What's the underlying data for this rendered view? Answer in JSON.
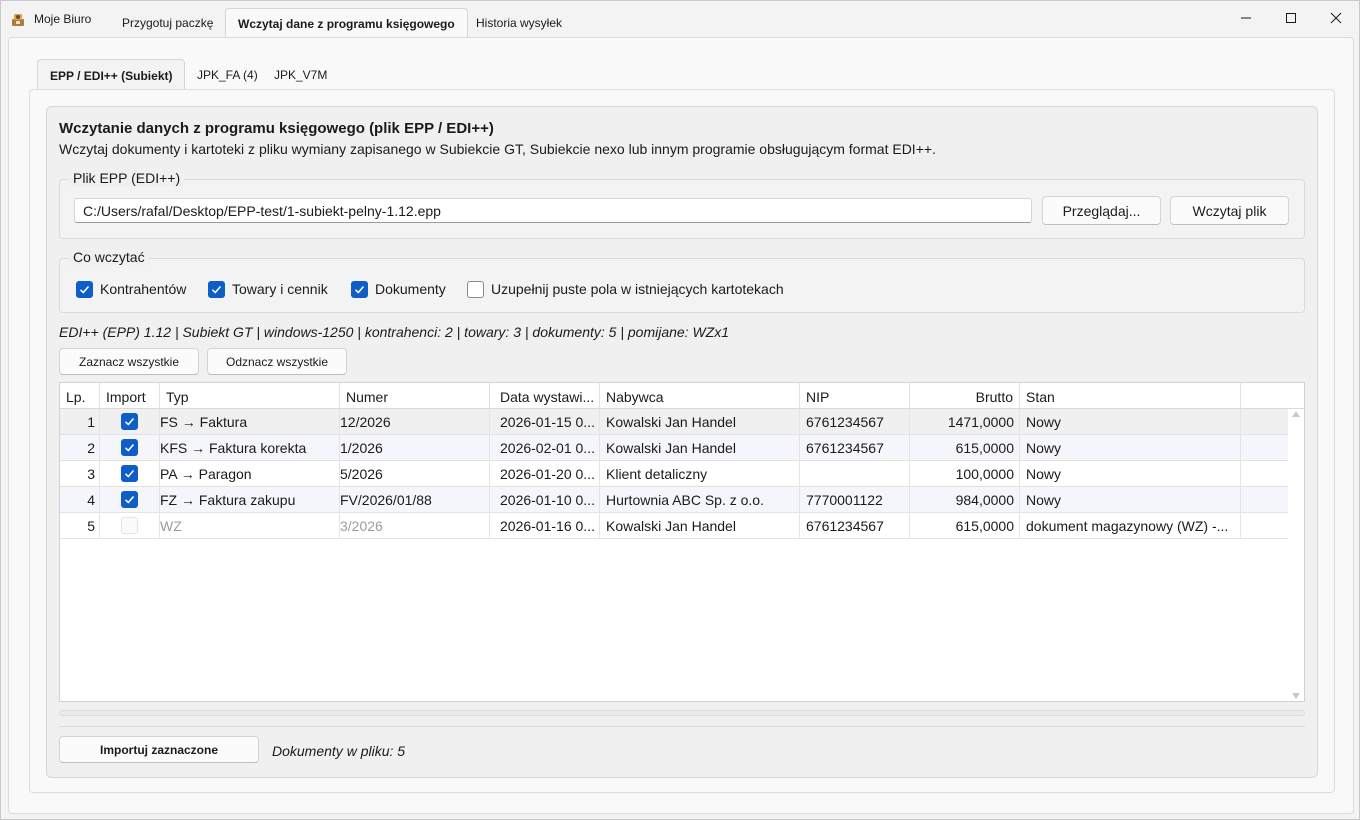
{
  "app": {
    "title": "Moje Biuro"
  },
  "top_tabs": [
    {
      "label": "Przygotuj paczkę"
    },
    {
      "label": "Wczytaj dane z programu księgowego"
    },
    {
      "label": "Historia wysyłek"
    }
  ],
  "sub_tabs": [
    {
      "label": "EPP / EDI++ (Subiekt)"
    },
    {
      "label": "JPK_FA (4)"
    },
    {
      "label": "JPK_V7M"
    }
  ],
  "panel": {
    "heading": "Wczytanie danych z programu księgowego (plik EPP / EDI++)",
    "subheading": "Wczytaj dokumenty i kartoteki z pliku wymiany zapisanego w Subiekcie GT, Subiekcie nexo lub innym programie obsługującym format EDI++."
  },
  "file_group": {
    "legend": "Plik EPP (EDI++)",
    "path": "C:/Users/rafal/Desktop/EPP-test/1-subiekt-pelny-1.12.epp",
    "browse_label": "Przeglądaj...",
    "load_label": "Wczytaj plik"
  },
  "options_group": {
    "legend": "Co wczytać",
    "options": [
      {
        "label": "Kontrahentów",
        "checked": true
      },
      {
        "label": "Towary i cennik",
        "checked": true
      },
      {
        "label": "Dokumenty",
        "checked": true
      },
      {
        "label": "Uzupełnij puste pola w istniejących kartotekach",
        "checked": false
      }
    ]
  },
  "info_line": "EDI++ (EPP) 1.12  |  Subiekt GT  |  windows-1250  |  kontrahenci: 2  |  towary: 3  |  dokumenty: 5  |  pomijane: WZx1",
  "selection": {
    "select_all_label": "Zaznacz wszystkie",
    "deselect_all_label": "Odznacz wszystkie"
  },
  "table": {
    "columns": [
      "Lp.",
      "Import",
      "Typ",
      "Numer",
      "Data wystawi...",
      "Nabywca",
      "NIP",
      "Brutto",
      "Stan"
    ],
    "rows": [
      {
        "lp": "1",
        "import": true,
        "typ": "FS → Faktura",
        "numer": "12/2026",
        "data": "2026-01-15 0...",
        "nabywca": "Kowalski Jan Handel",
        "nip": "6761234567",
        "brutto": "1471,0000",
        "stan": "Nowy",
        "disabled": false
      },
      {
        "lp": "2",
        "import": true,
        "typ": "KFS → Faktura korekta",
        "numer": "1/2026",
        "data": "2026-02-01 0...",
        "nabywca": "Kowalski Jan Handel",
        "nip": "6761234567",
        "brutto": "615,0000",
        "stan": "Nowy",
        "disabled": false
      },
      {
        "lp": "3",
        "import": true,
        "typ": "PA → Paragon",
        "numer": "5/2026",
        "data": "2026-01-20 0...",
        "nabywca": "Klient detaliczny",
        "nip": "",
        "brutto": "100,0000",
        "stan": "Nowy",
        "disabled": false
      },
      {
        "lp": "4",
        "import": true,
        "typ": "FZ → Faktura zakupu",
        "numer": "FV/2026/01/88",
        "data": "2026-01-10 0...",
        "nabywca": "Hurtownia ABC Sp. z o.o.",
        "nip": "7770001122",
        "brutto": "984,0000",
        "stan": "Nowy",
        "disabled": false
      },
      {
        "lp": "5",
        "import": false,
        "typ": "WZ",
        "numer": "3/2026",
        "data": "2026-01-16 0...",
        "nabywca": "Kowalski Jan Handel",
        "nip": "6761234567",
        "brutto": "615,0000",
        "stan": "dokument magazynowy (WZ) -...",
        "disabled": true
      }
    ]
  },
  "footer": {
    "import_label": "Importuj zaznaczone",
    "status": "Dokumenty w pliku: 5"
  },
  "colors": {
    "accent": "#0f5ec8",
    "muted_text": "#9c9c9c"
  }
}
